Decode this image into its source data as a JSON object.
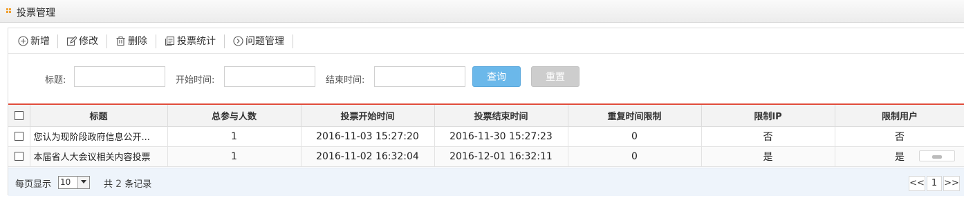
{
  "header": {
    "title": "投票管理"
  },
  "toolbar": {
    "add": "新增",
    "edit": "修改",
    "delete": "删除",
    "stats": "投票统计",
    "questions": "问题管理"
  },
  "search": {
    "title_label": "标题:",
    "start_label": "开始时间:",
    "end_label": "结束时间:",
    "query": "查询",
    "reset": "重置"
  },
  "table": {
    "columns": [
      "标题",
      "总参与人数",
      "投票开始时间",
      "投票结束时间",
      "重复时间限制",
      "限制IP",
      "限制用户"
    ],
    "rows": [
      [
        "您认为现阶段政府信息公开...",
        "1",
        "2016-11-03 15:27:20",
        "2016-11-30 15:27:23",
        "0",
        "否",
        "否"
      ],
      [
        "本届省人大会议相关内容投票",
        "1",
        "2016-11-02 16:32:04",
        "2016-12-01 16:32:11",
        "0",
        "是",
        "是"
      ]
    ]
  },
  "pager": {
    "page_size_label": "每页显示",
    "page_size": "10",
    "total_prefix": "共",
    "total_count": "2",
    "total_suffix": "条记录",
    "prev": "<<",
    "current": "1",
    "next": ">>"
  }
}
